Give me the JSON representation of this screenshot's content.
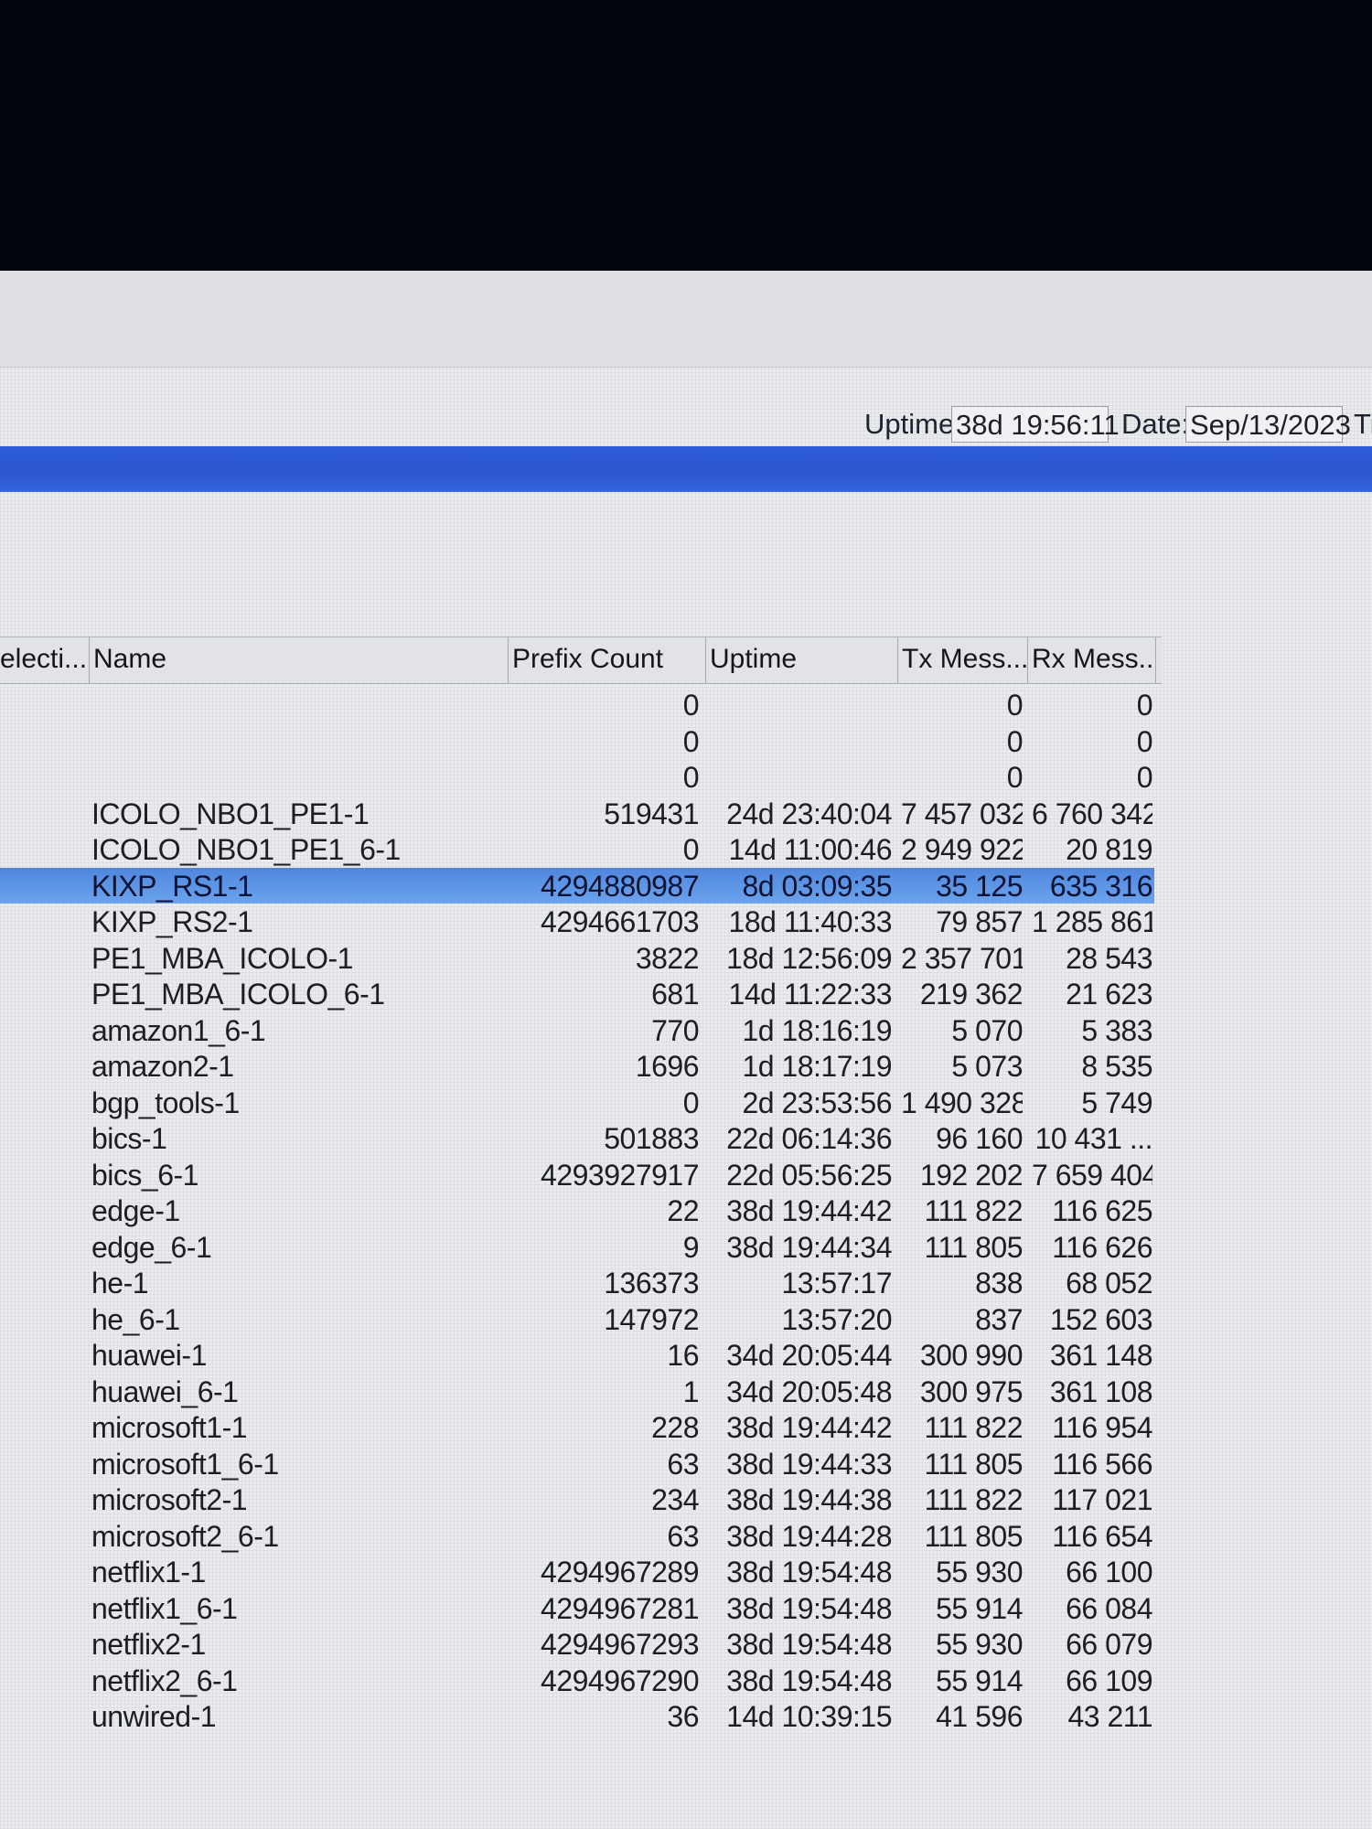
{
  "status": {
    "uptime_label": "Uptime:",
    "uptime_value": "38d 19:56:11",
    "date_label": "Date:",
    "date_value": "Sep/13/2023",
    "cut_label": "Ti"
  },
  "columns": {
    "selection": "electi...",
    "name": "Name",
    "prefix_count": "Prefix Count",
    "uptime": "Uptime",
    "tx_messages": "Tx Mess...",
    "rx_messages": "Rx Mess..."
  },
  "rows": [
    {
      "name": "",
      "prefix": "0",
      "uptime": "",
      "tx": "0",
      "rx": "0"
    },
    {
      "name": "",
      "prefix": "0",
      "uptime": "",
      "tx": "0",
      "rx": "0"
    },
    {
      "name": "",
      "prefix": "0",
      "uptime": "",
      "tx": "0",
      "rx": "0"
    },
    {
      "name": "ICOLO_NBO1_PE1-1",
      "prefix": "519431",
      "uptime": "24d 23:40:04",
      "tx": "7 457 032",
      "rx": "6 760 342"
    },
    {
      "name": "ICOLO_NBO1_PE1_6-1",
      "prefix": "0",
      "uptime": "14d 11:00:46",
      "tx": "2 949 922",
      "rx": "20 819"
    },
    {
      "name": "KIXP_RS1-1",
      "prefix": "4294880987",
      "uptime": "8d 03:09:35",
      "tx": "35 125",
      "rx": "635 316",
      "selected": true
    },
    {
      "name": "KIXP_RS2-1",
      "prefix": "4294661703",
      "uptime": "18d 11:40:33",
      "tx": "79 857",
      "rx": "1 285 861"
    },
    {
      "name": "PE1_MBA_ICOLO-1",
      "prefix": "3822",
      "uptime": "18d 12:56:09",
      "tx": "2 357 701",
      "rx": "28 543"
    },
    {
      "name": "PE1_MBA_ICOLO_6-1",
      "prefix": "681",
      "uptime": "14d 11:22:33",
      "tx": "219 362",
      "rx": "21 623"
    },
    {
      "name": "amazon1_6-1",
      "prefix": "770",
      "uptime": "1d 18:16:19",
      "tx": "5 070",
      "rx": "5 383"
    },
    {
      "name": "amazon2-1",
      "prefix": "1696",
      "uptime": "1d 18:17:19",
      "tx": "5 073",
      "rx": "8 535"
    },
    {
      "name": "bgp_tools-1",
      "prefix": "0",
      "uptime": "2d 23:53:56",
      "tx": "1 490 328",
      "rx": "5 749"
    },
    {
      "name": "bics-1",
      "prefix": "501883",
      "uptime": "22d 06:14:36",
      "tx": "96 160",
      "rx": "10 431 ..."
    },
    {
      "name": "bics_6-1",
      "prefix": "4293927917",
      "uptime": "22d 05:56:25",
      "tx": "192 202",
      "rx": "7 659 404"
    },
    {
      "name": "edge-1",
      "prefix": "22",
      "uptime": "38d 19:44:42",
      "tx": "111 822",
      "rx": "116 625"
    },
    {
      "name": "edge_6-1",
      "prefix": "9",
      "uptime": "38d 19:44:34",
      "tx": "111 805",
      "rx": "116 626"
    },
    {
      "name": "he-1",
      "prefix": "136373",
      "uptime": "13:57:17",
      "tx": "838",
      "rx": "68 052"
    },
    {
      "name": "he_6-1",
      "prefix": "147972",
      "uptime": "13:57:20",
      "tx": "837",
      "rx": "152 603"
    },
    {
      "name": "huawei-1",
      "prefix": "16",
      "uptime": "34d 20:05:44",
      "tx": "300 990",
      "rx": "361 148"
    },
    {
      "name": "huawei_6-1",
      "prefix": "1",
      "uptime": "34d 20:05:48",
      "tx": "300 975",
      "rx": "361 108"
    },
    {
      "name": "microsoft1-1",
      "prefix": "228",
      "uptime": "38d 19:44:42",
      "tx": "111 822",
      "rx": "116 954"
    },
    {
      "name": "microsoft1_6-1",
      "prefix": "63",
      "uptime": "38d 19:44:33",
      "tx": "111 805",
      "rx": "116 566"
    },
    {
      "name": "microsoft2-1",
      "prefix": "234",
      "uptime": "38d 19:44:38",
      "tx": "111 822",
      "rx": "117 021"
    },
    {
      "name": "microsoft2_6-1",
      "prefix": "63",
      "uptime": "38d 19:44:28",
      "tx": "111 805",
      "rx": "116 654"
    },
    {
      "name": "netflix1-1",
      "prefix": "4294967289",
      "uptime": "38d 19:54:48",
      "tx": "55 930",
      "rx": "66 100"
    },
    {
      "name": "netflix1_6-1",
      "prefix": "4294967281",
      "uptime": "38d 19:54:48",
      "tx": "55 914",
      "rx": "66 084"
    },
    {
      "name": "netflix2-1",
      "prefix": "4294967293",
      "uptime": "38d 19:54:48",
      "tx": "55 930",
      "rx": "66 079"
    },
    {
      "name": "netflix2_6-1",
      "prefix": "4294967290",
      "uptime": "38d 19:54:48",
      "tx": "55 914",
      "rx": "66 109"
    },
    {
      "name": "unwired-1",
      "prefix": "36",
      "uptime": "14d 10:39:15",
      "tx": "41 596",
      "rx": "43 211"
    }
  ]
}
